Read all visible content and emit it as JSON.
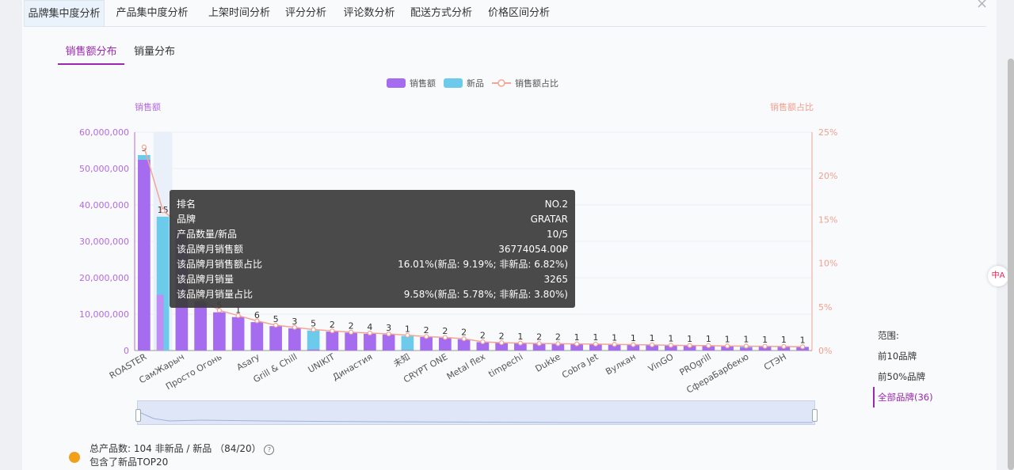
{
  "tabs": [
    "品牌集中度分析",
    "产品集中度分析",
    "上架时间分析",
    "评分分析",
    "评论数分析",
    "配送方式分析",
    "价格区间分析"
  ],
  "subtabs": [
    "销售额分布",
    "销量分布"
  ],
  "legend": {
    "sales": "销售额",
    "new": "新品",
    "ratio": "销售额占比"
  },
  "colors": {
    "sales": "#a66cf0",
    "new": "#6ccbea",
    "ratio": "#f2a594",
    "accent": "#9c27b0"
  },
  "axis": {
    "left_title": "销售额",
    "right_title": "销售额占比"
  },
  "chart_data": {
    "type": "bar",
    "y_left_ticks": [
      "0",
      "10,000,000",
      "20,000,000",
      "30,000,000",
      "40,000,000",
      "50,000,000",
      "60,000,000"
    ],
    "y_right_ticks": [
      "0%",
      "5%",
      "10%",
      "15%",
      "20%",
      "25%"
    ],
    "ylim_left": [
      0,
      60000000
    ],
    "ylim_right": [
      0,
      25
    ],
    "visible_x_labels": [
      "ROASTER",
      "СамЖарыч",
      "Просто Огонь",
      "Asary",
      "Grill & Chill",
      "UNIKIT",
      "Династия",
      "未知",
      "CRYPT ONE",
      "Metal flex",
      "timpechi",
      "Dukke",
      "Cobra Jet",
      "Вулкан",
      "VinGO",
      "PROgrill",
      "СфераБарбекю",
      "СТЭН"
    ],
    "sales": [
      53700000,
      36774054,
      33000000,
      13500000,
      10500000,
      9200000,
      7800000,
      6700000,
      6100000,
      5500000,
      5200000,
      4900000,
      4600000,
      4400000,
      4000000,
      3700000,
      3500000,
      3100000,
      2300000,
      2100000,
      2000000,
      1900000,
      1800000,
      1750000,
      1700000,
      1600000,
      1550000,
      1500000,
      1400000,
      1350000,
      1300000,
      1200000,
      1150000,
      1100000,
      1050000,
      1000000
    ],
    "new_sales": [
      1300000,
      21000000,
      0,
      0,
      0,
      0,
      0,
      0,
      0,
      5200000,
      0,
      0,
      0,
      0,
      3900000,
      0,
      0,
      0,
      0,
      0,
      0,
      0,
      0,
      0,
      0,
      0,
      0,
      0,
      0,
      0,
      0,
      0,
      300000,
      0,
      0,
      0
    ],
    "ratio": [
      23.3,
      16.01,
      14.3,
      5.9,
      4.6,
      4.0,
      3.4,
      2.9,
      2.65,
      2.4,
      2.25,
      2.1,
      2.0,
      1.9,
      1.75,
      1.6,
      1.5,
      1.35,
      1.0,
      0.9,
      0.85,
      0.8,
      0.78,
      0.76,
      0.74,
      0.7,
      0.67,
      0.65,
      0.6,
      0.58,
      0.56,
      0.52,
      0.5,
      0.48,
      0.46,
      0.43
    ],
    "counts": [
      "9",
      "15",
      "",
      "8",
      "5",
      "1",
      "6",
      "5",
      "3",
      "5",
      "2",
      "2",
      "4",
      "3",
      "1",
      "2",
      "2",
      "2",
      "2",
      "2",
      "1",
      "2",
      "2",
      "1",
      "1",
      "1",
      "1",
      "1",
      "1",
      "1",
      "1",
      "1",
      "1",
      "1",
      "1",
      "1"
    ]
  },
  "tooltip": {
    "rows": [
      {
        "k": "排名",
        "v": "NO.2"
      },
      {
        "k": "品牌",
        "v": "GRATAR"
      },
      {
        "k": "产品数量/新品",
        "v": "10/5"
      },
      {
        "k": "该品牌月销售额",
        "v": "36774054.00₽"
      },
      {
        "k": "该品牌月销售额占比",
        "v": "16.01%(新品: 9.19%; 非新品: 6.82%)"
      },
      {
        "k": "该品牌月销量",
        "v": "3265"
      },
      {
        "k": "该品牌月销量占比",
        "v": "9.58%(新品: 5.78%; 非新品: 3.80%)"
      }
    ]
  },
  "range": {
    "title": "范围:",
    "options": [
      "前10品牌",
      "前50%品牌",
      "全部品牌(36)"
    ]
  },
  "summary": {
    "line1": "总产品数: 104 非新品 / 新品 （84/20）",
    "line2": "包含了新品TOP20",
    "help": "?"
  },
  "close": "×",
  "side_badge": "中A"
}
